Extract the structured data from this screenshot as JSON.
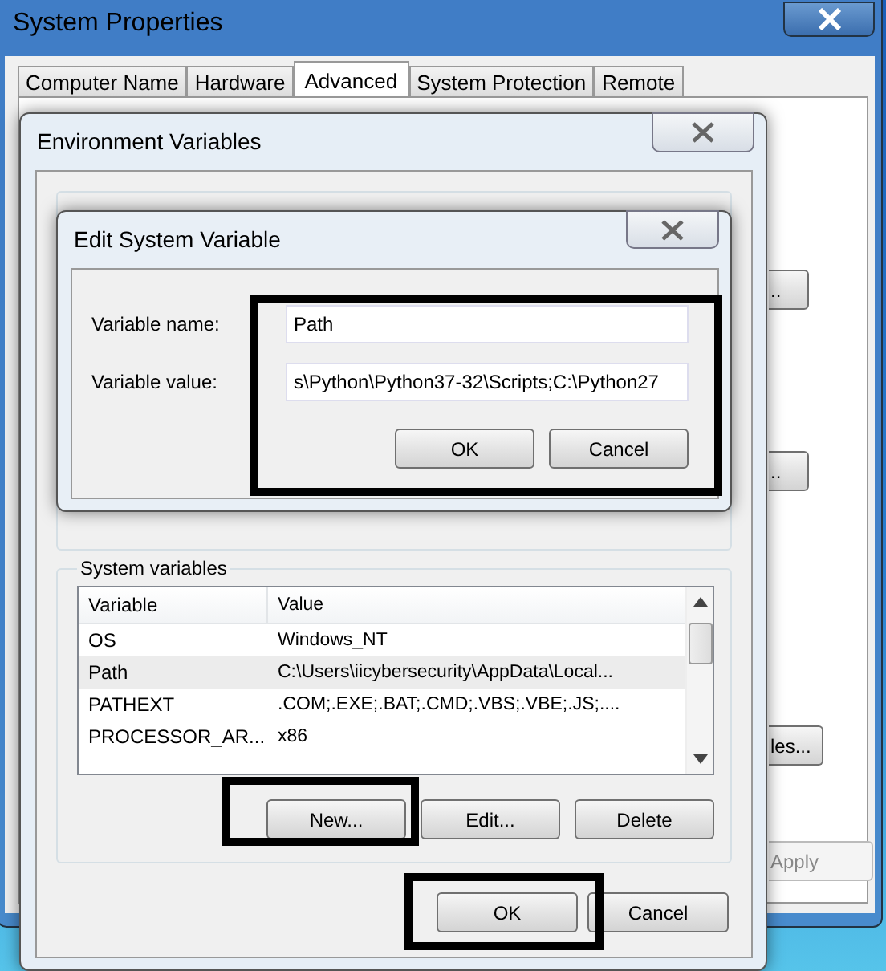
{
  "system_properties": {
    "title": "System Properties",
    "tabs": [
      {
        "label": "Computer Name",
        "selected": false
      },
      {
        "label": "Hardware",
        "selected": false
      },
      {
        "label": "Advanced",
        "selected": true
      },
      {
        "label": "System Protection",
        "selected": false
      },
      {
        "label": "Remote",
        "selected": false
      }
    ],
    "side_buttons": [
      {
        "label": "..",
        "disabled": false
      },
      {
        "label": "..",
        "disabled": false
      },
      {
        "label": "les...",
        "disabled": false
      },
      {
        "label": "Apply",
        "disabled": true
      }
    ]
  },
  "environment_variables": {
    "title": "Environment Variables",
    "system_variables": {
      "legend": "System variables",
      "columns": [
        "Variable",
        "Value"
      ],
      "rows": [
        {
          "variable": "OS",
          "value": "Windows_NT",
          "selected": false
        },
        {
          "variable": "Path",
          "value": "C:\\Users\\iicybersecurity\\AppData\\Local...",
          "selected": true
        },
        {
          "variable": "PATHEXT",
          "value": ".COM;.EXE;.BAT;.CMD;.VBS;.VBE;.JS;....",
          "selected": false
        },
        {
          "variable": "PROCESSOR_AR...",
          "value": "x86",
          "selected": false
        }
      ],
      "buttons": [
        "New...",
        "Edit...",
        "Delete"
      ]
    },
    "buttons": [
      "OK",
      "Cancel"
    ]
  },
  "edit_dialog": {
    "title": "Edit System Variable",
    "fields": [
      {
        "label": "Variable name:",
        "value": "Path"
      },
      {
        "label": "Variable value:",
        "value": "s\\Python\\Python37-32\\Scripts;C:\\Python27"
      }
    ],
    "buttons": [
      "OK",
      "Cancel"
    ]
  }
}
